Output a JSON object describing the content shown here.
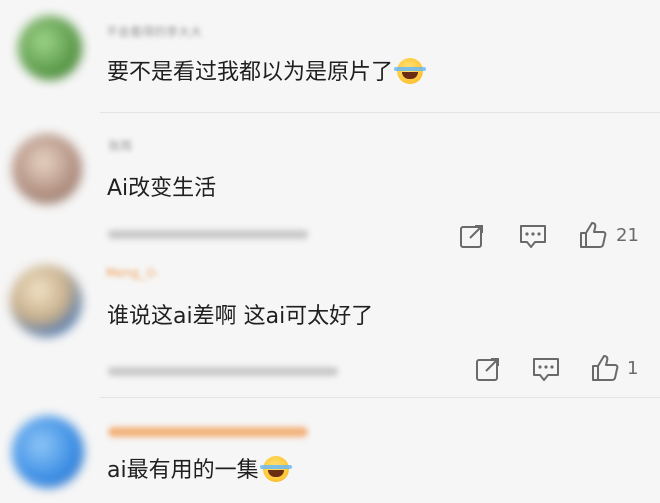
{
  "comments": [
    {
      "username": "不会看得的李大大",
      "text": "要不是看过我都以为是原片了",
      "emoji": "laugh-cry"
    },
    {
      "username": "张雨",
      "text": "Ai改变生活",
      "actions": {
        "likes": "21"
      }
    },
    {
      "username": "Meng_小",
      "text": "谁说这ai差啊 这ai可太好了",
      "actions": {
        "likes": "1"
      }
    },
    {
      "username": "",
      "text": "ai最有用的一集",
      "emoji": "laugh-cry"
    }
  ],
  "colors": {
    "background": "#f6f6f6",
    "text": "#1f1f1f",
    "icon": "#6a6a6a",
    "username_orange": "#f0a057"
  }
}
